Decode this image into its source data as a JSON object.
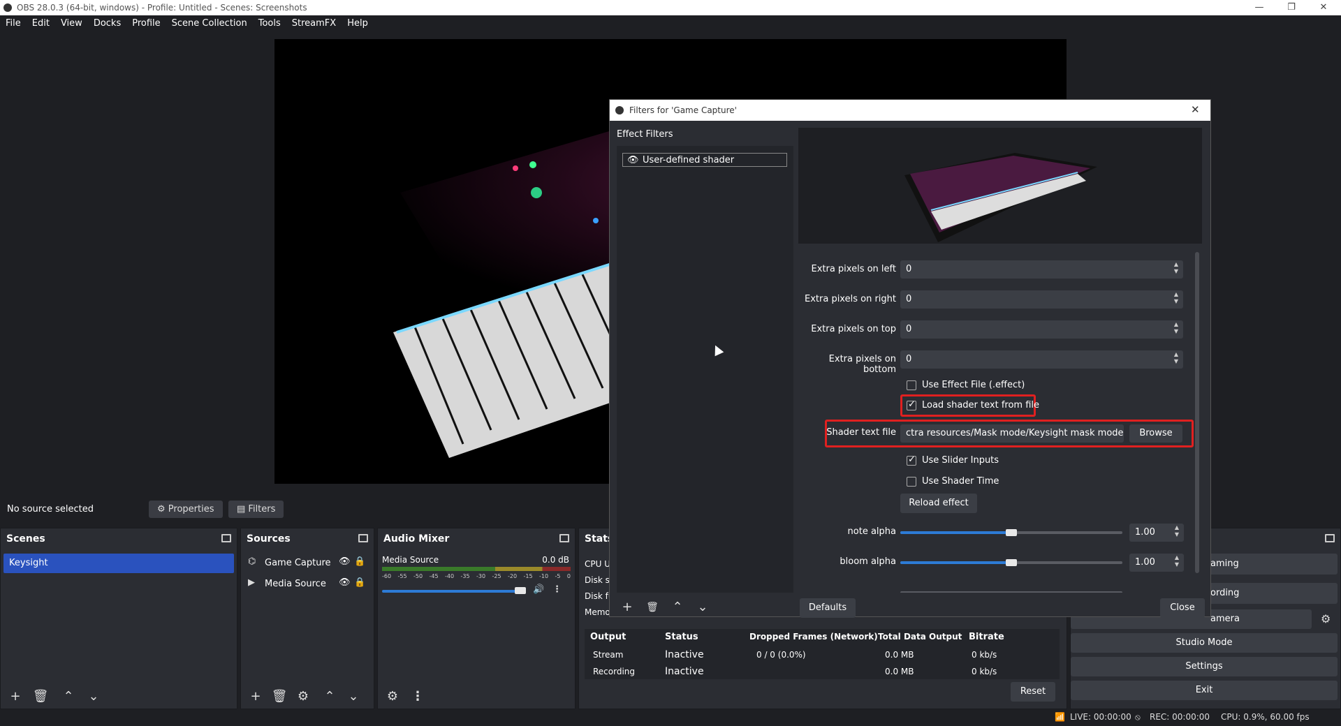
{
  "window": {
    "title": "OBS 28.0.3 (64-bit, windows) - Profile: Untitled - Scenes: Screenshots"
  },
  "menu": [
    "File",
    "Edit",
    "View",
    "Docks",
    "Profile",
    "Scene Collection",
    "Tools",
    "StreamFX",
    "Help"
  ],
  "source_bar": {
    "no_source": "No source selected",
    "properties": "Properties",
    "filters": "Filters"
  },
  "scenes": {
    "title": "Scenes",
    "items": [
      "Keysight"
    ]
  },
  "sources": {
    "title": "Sources",
    "items": [
      "Game Capture",
      "Media Source"
    ]
  },
  "mixer": {
    "title": "Audio Mixer",
    "channel": "Media Source",
    "level": "0.0 dB",
    "ticks": [
      "-60",
      "-55",
      "-50",
      "-45",
      "-40",
      "-35",
      "-30",
      "-25",
      "-20",
      "-15",
      "-10",
      "-5",
      "0"
    ]
  },
  "stats": {
    "title": "Stats",
    "rows": [
      "CPU U",
      "Disk sp",
      "Disk fu",
      "Memo"
    ],
    "headers": [
      "Output",
      "Status",
      "Dropped Frames (Network)",
      "Total Data Output",
      "Bitrate"
    ],
    "table": [
      [
        "Stream",
        "Inactive",
        "0 / 0 (0.0%)",
        "0.0 MB",
        "0 kb/s"
      ],
      [
        "Recording",
        "Inactive",
        "",
        "0.0 MB",
        "0 kb/s"
      ]
    ],
    "reset": "Reset"
  },
  "controls": {
    "items": [
      "aming",
      "ording",
      "amera",
      "Studio Mode",
      "Settings",
      "Exit"
    ]
  },
  "status_bar": {
    "live": "LIVE: 00:00:00",
    "rec": "REC: 00:00:00",
    "cpu": "CPU: 0.9%, 60.00 fps"
  },
  "dialog": {
    "title": "Filters for 'Game Capture'",
    "effect_filters_label": "Effect Filters",
    "filters": [
      "User-defined shader"
    ],
    "fields": [
      {
        "label": "Extra pixels on left",
        "value": "0"
      },
      {
        "label": "Extra pixels on right",
        "value": "0"
      },
      {
        "label": "Extra pixels on top",
        "value": "0"
      },
      {
        "label": "Extra pixels on bottom",
        "value": "0"
      }
    ],
    "use_effect_file": "Use Effect File (.effect)",
    "load_shader": "Load shader text from file",
    "shader_file_label": "Shader text file",
    "shader_file_value": "ctra resources/Mask mode/Keysight mask mode.txt",
    "browse": "Browse",
    "use_slider": "Use Slider Inputs",
    "use_time": "Use Shader Time",
    "reload": "Reload effect",
    "sliders": [
      {
        "label": "note alpha",
        "value": "1.00",
        "level": 0.5
      },
      {
        "label": "bloom alpha",
        "value": "1.00",
        "level": 0.5
      }
    ],
    "defaults": "Defaults",
    "close": "Close"
  },
  "colors": {
    "accent": "#2d7bd6",
    "highlight": "#e02020",
    "selected_scene": "#2a52be"
  }
}
